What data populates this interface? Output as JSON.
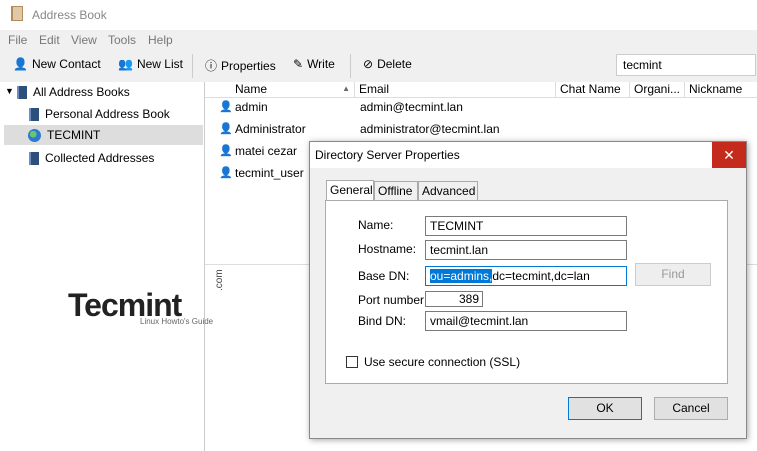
{
  "window": {
    "title": "Address Book",
    "icon": "address-book-icon"
  },
  "menu": [
    "File",
    "Edit",
    "View",
    "Tools",
    "Help"
  ],
  "toolbar": {
    "new_contact": "New Contact",
    "new_list": "New List",
    "properties": "Properties",
    "write": "Write",
    "delete": "Delete",
    "search_value": "tecmint"
  },
  "sidebar": {
    "items": [
      {
        "label": "All Address Books",
        "icon": "book-icon"
      },
      {
        "label": "Personal Address Book",
        "icon": "book-icon"
      },
      {
        "label": "TECMINT",
        "icon": "globe-icon"
      },
      {
        "label": "Collected Addresses",
        "icon": "book-icon"
      }
    ]
  },
  "list": {
    "columns": [
      "Name",
      "Email",
      "Chat Name",
      "Organi...",
      "Nickname"
    ],
    "rows": [
      {
        "name": "admin",
        "email": "admin@tecmint.lan"
      },
      {
        "name": "Administrator",
        "email": "administrator@tecmint.lan"
      },
      {
        "name": "matei cezar",
        "email": ""
      },
      {
        "name": "tecmint_user",
        "email": ""
      }
    ]
  },
  "watermark": {
    "brand": "Tecmint",
    "tagline": "Linux Howto's Guide",
    "suffix": ".com"
  },
  "dialog": {
    "title": "Directory Server Properties",
    "close": "✕",
    "tabs": [
      "General",
      "Offline",
      "Advanced"
    ],
    "fields": {
      "name_label": "Name:",
      "name_value": "TECMINT",
      "hostname_label": "Hostname:",
      "hostname_value": "tecmint.lan",
      "basedn_label": "Base DN:",
      "basedn_selected": "ou=admins,",
      "basedn_rest": "dc=tecmint,dc=lan",
      "port_label": "Port number:",
      "port_value": "389",
      "binddn_label": "Bind DN:",
      "binddn_value": "vmail@tecmint.lan"
    },
    "find_label": "Find",
    "ssl_label": "Use secure connection (SSL)",
    "ssl_checked": false,
    "ok_label": "OK",
    "cancel_label": "Cancel"
  },
  "colors": {
    "accent": "#0078d7",
    "close_red": "#c42b1c"
  }
}
